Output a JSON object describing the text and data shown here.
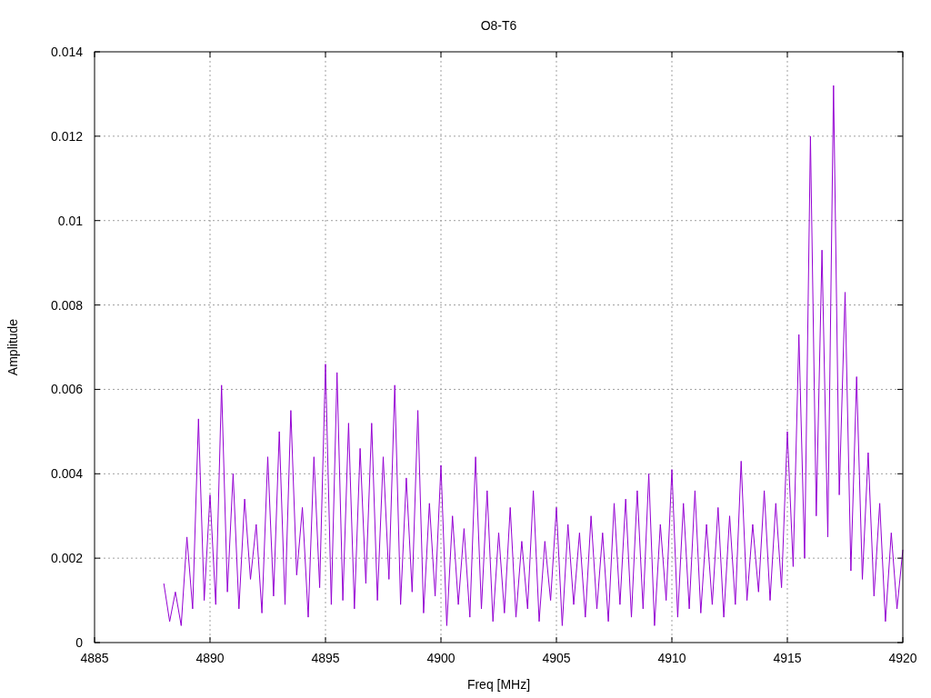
{
  "chart_data": {
    "type": "line",
    "title": "O8-T6",
    "xlabel": "Freq [MHz]",
    "ylabel": "Amplitude",
    "grid": true,
    "xlim": [
      4885,
      4920
    ],
    "ylim": [
      0,
      0.014
    ],
    "xticks": [
      4885,
      4890,
      4895,
      4900,
      4905,
      4910,
      4915,
      4920
    ],
    "yticks": [
      0,
      0.002,
      0.004,
      0.006,
      0.008,
      0.01,
      0.012,
      0.014
    ],
    "x": [
      4888,
      4888.25,
      4888.5,
      4888.75,
      4889,
      4889.25,
      4889.5,
      4889.75,
      4890,
      4890.25,
      4890.5,
      4890.75,
      4891,
      4891.25,
      4891.5,
      4891.75,
      4892,
      4892.25,
      4892.5,
      4892.75,
      4893,
      4893.25,
      4893.5,
      4893.75,
      4894,
      4894.25,
      4894.5,
      4894.75,
      4895,
      4895.25,
      4895.5,
      4895.75,
      4896,
      4896.25,
      4896.5,
      4896.75,
      4897,
      4897.25,
      4897.5,
      4897.75,
      4898,
      4898.25,
      4898.5,
      4898.75,
      4899,
      4899.25,
      4899.5,
      4899.75,
      4900,
      4900.25,
      4900.5,
      4900.75,
      4901,
      4901.25,
      4901.5,
      4901.75,
      4902,
      4902.25,
      4902.5,
      4902.75,
      4903,
      4903.25,
      4903.5,
      4903.75,
      4904,
      4904.25,
      4904.5,
      4904.75,
      4905,
      4905.25,
      4905.5,
      4905.75,
      4906,
      4906.25,
      4906.5,
      4906.75,
      4907,
      4907.25,
      4907.5,
      4907.75,
      4908,
      4908.25,
      4908.5,
      4908.75,
      4909,
      4909.25,
      4909.5,
      4909.75,
      4910,
      4910.25,
      4910.5,
      4910.75,
      4911,
      4911.25,
      4911.5,
      4911.75,
      4912,
      4912.25,
      4912.5,
      4912.75,
      4913,
      4913.25,
      4913.5,
      4913.75,
      4914,
      4914.25,
      4914.5,
      4914.75,
      4915,
      4915.25,
      4915.5,
      4915.75,
      4916,
      4916.25,
      4916.5,
      4916.75,
      4917,
      4917.25,
      4917.5,
      4917.75,
      4918,
      4918.25,
      4918.5,
      4918.75,
      4919,
      4919.25,
      4919.5,
      4919.75,
      4920
    ],
    "series": [
      {
        "color": "#9400d3",
        "values": [
          0.0014,
          0.0005,
          0.0012,
          0.0004,
          0.0025,
          0.0008,
          0.0053,
          0.001,
          0.0035,
          0.0009,
          0.0061,
          0.0012,
          0.004,
          0.0008,
          0.0034,
          0.0015,
          0.0028,
          0.0007,
          0.0044,
          0.0011,
          0.005,
          0.0009,
          0.0055,
          0.0016,
          0.0032,
          0.0006,
          0.0044,
          0.0013,
          0.0066,
          0.0009,
          0.0064,
          0.001,
          0.0052,
          0.0008,
          0.0046,
          0.0014,
          0.0052,
          0.001,
          0.0044,
          0.0015,
          0.0061,
          0.0009,
          0.0039,
          0.0012,
          0.0055,
          0.0007,
          0.0033,
          0.0011,
          0.0042,
          0.0004,
          0.003,
          0.0009,
          0.0027,
          0.0006,
          0.0044,
          0.0008,
          0.0036,
          0.0005,
          0.0026,
          0.0007,
          0.0032,
          0.0006,
          0.0024,
          0.0008,
          0.0036,
          0.0005,
          0.0024,
          0.001,
          0.0032,
          0.0004,
          0.0028,
          0.0009,
          0.0026,
          0.0006,
          0.003,
          0.0008,
          0.0026,
          0.0005,
          0.0033,
          0.0009,
          0.0034,
          0.0006,
          0.0036,
          0.0008,
          0.004,
          0.0004,
          0.0028,
          0.001,
          0.0041,
          0.0006,
          0.0033,
          0.0008,
          0.0036,
          0.0007,
          0.0028,
          0.0009,
          0.0032,
          0.0006,
          0.003,
          0.0009,
          0.0043,
          0.001,
          0.0028,
          0.0012,
          0.0036,
          0.001,
          0.0033,
          0.0013,
          0.005,
          0.0018,
          0.0073,
          0.002,
          0.012,
          0.003,
          0.0093,
          0.0025,
          0.0132,
          0.0035,
          0.0083,
          0.0017,
          0.0063,
          0.0015,
          0.0045,
          0.0011,
          0.0033,
          0.0005,
          0.0026,
          0.0008,
          0.0022
        ]
      }
    ]
  }
}
